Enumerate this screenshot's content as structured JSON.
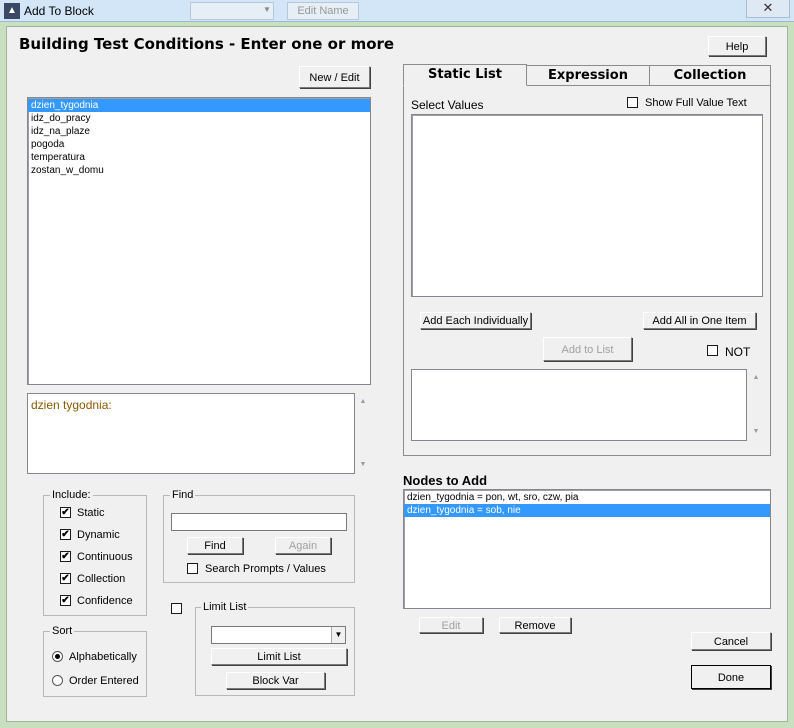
{
  "window": {
    "title": "Add To Block",
    "close_glyph": "✕",
    "bg_button": "Edit Name"
  },
  "dialog": {
    "heading": "Building Test Conditions - Enter one or more",
    "help_label": "Help",
    "new_edit_label": "New / Edit",
    "variables": [
      "dzien_tygodnia",
      "idz_do_pracy",
      "idz_na_plaze",
      "pogoda",
      "temperatura",
      "zostan_w_domu"
    ],
    "selected_variable_index": 0,
    "description": "dzien tygodnia:",
    "include": {
      "legend": "Include:",
      "options": [
        {
          "label": "Static",
          "checked": true
        },
        {
          "label": "Dynamic",
          "checked": true
        },
        {
          "label": "Continuous",
          "checked": true
        },
        {
          "label": "Collection",
          "checked": true
        },
        {
          "label": "Confidence",
          "checked": true
        }
      ]
    },
    "find": {
      "legend": "Find",
      "value": "",
      "find_label": "Find",
      "again_label": "Again",
      "search_prompts_label": "Search Prompts / Values",
      "search_prompts_checked": false
    },
    "sort": {
      "legend": "Sort",
      "options": [
        {
          "label": "Alphabetically",
          "selected": true
        },
        {
          "label": "Order Entered",
          "selected": false
        }
      ]
    },
    "limit": {
      "legend": "Limit List",
      "checked": false,
      "select_value": "",
      "limit_list_label": "Limit List",
      "block_var_label": "Block Var"
    },
    "tabs": [
      "Static List",
      "Expression",
      "Collection"
    ],
    "active_tab_index": 0,
    "static_list": {
      "select_values_label": "Select Values",
      "show_full_label": "Show Full Value Text",
      "show_full_checked": false,
      "add_each_label": "Add Each Individually",
      "add_all_label": "Add All in One Item",
      "add_to_list_label": "Add to List",
      "not_label": "NOT",
      "not_checked": false
    },
    "nodes": {
      "label": "Nodes to Add",
      "items": [
        "dzien_tygodnia = pon, wt, sro, czw, pia",
        "dzien_tygodnia = sob, nie"
      ],
      "selected_index": 1,
      "edit_label": "Edit",
      "remove_label": "Remove"
    },
    "cancel_label": "Cancel",
    "done_label": "Done",
    "check_glyph": "✔",
    "dropdown_glyph": "▼",
    "scroll_up_glyph": "▲",
    "scroll_down_glyph": "▼"
  }
}
